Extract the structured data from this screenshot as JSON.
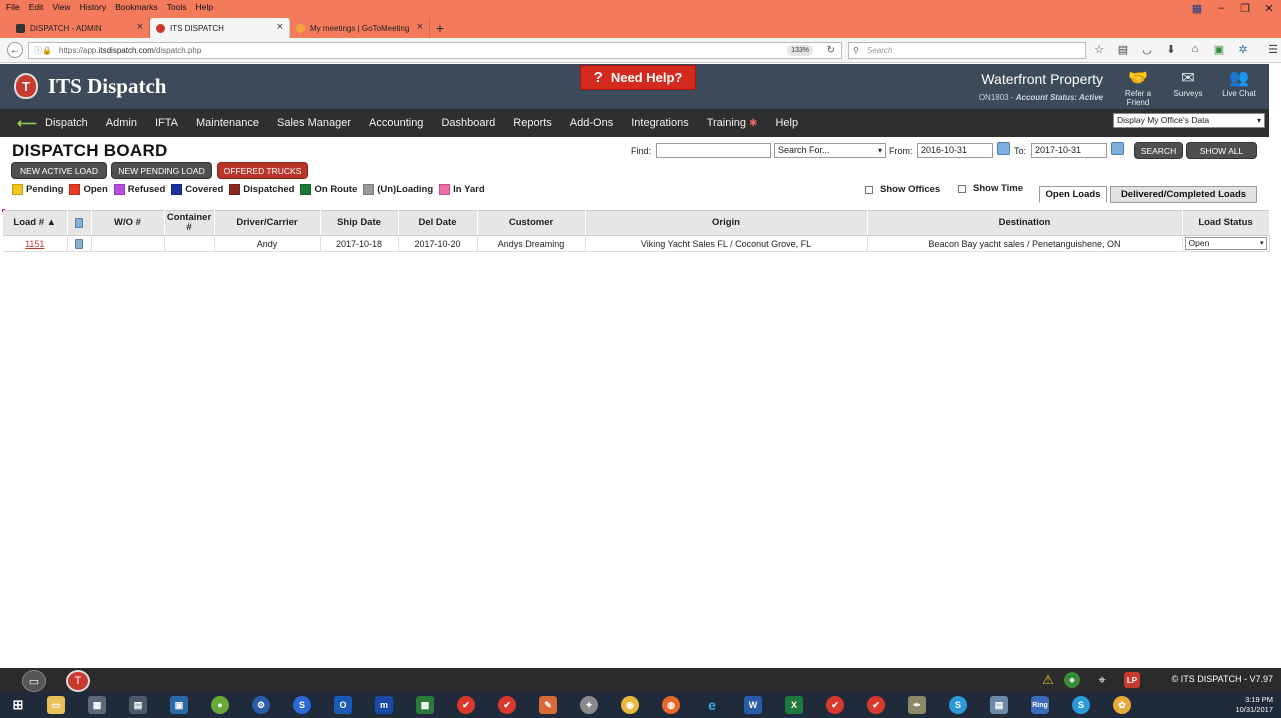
{
  "browser": {
    "menus": [
      "File",
      "Edit",
      "View",
      "History",
      "Bookmarks",
      "Tools",
      "Help"
    ],
    "tabs": [
      {
        "label": "DISPATCH - ADMIN",
        "active": false
      },
      {
        "label": "ITS DISPATCH",
        "active": true
      },
      {
        "label": "My meetings | GoToMeeting",
        "active": false
      }
    ],
    "url_prefix": "https://app.",
    "url_host": "itsdispatch.com",
    "url_path": "/dispatch.php",
    "zoom": "133%",
    "search_placeholder": "Search"
  },
  "app": {
    "logo_text": "ITS Dispatch",
    "need_help": "Need Help?",
    "company": "Waterfront Property",
    "account_id": "ON1803 - ",
    "account_status": "Account Status: Active",
    "header_icons": [
      {
        "name": "refer-a-friend",
        "label": "Refer a Friend"
      },
      {
        "name": "surveys",
        "label": "Surveys"
      },
      {
        "name": "live-chat",
        "label": "Live Chat"
      }
    ],
    "nav": [
      "Dispatch",
      "Admin",
      "IFTA",
      "Maintenance",
      "Sales Manager",
      "Accounting",
      "Dashboard",
      "Reports",
      "Add-Ons",
      "Integrations",
      "Training",
      "Help"
    ],
    "office_select": "Display My Office's Data"
  },
  "board": {
    "title": "DISPATCH BOARD",
    "buttons": {
      "new_active": "NEW ACTIVE LOAD",
      "new_pending": "NEW PENDING LOAD",
      "offered": "OFFERED TRUCKS"
    },
    "find_label": "Find:",
    "find_value": "",
    "search_for": "Search For...",
    "from_label": "From:",
    "from_value": "2016-10-31",
    "to_label": "To:",
    "to_value": "2017-10-31",
    "search_btn": "SEARCH",
    "show_all_btn": "SHOW ALL",
    "legend": [
      {
        "label": "Pending",
        "color": "#f5c518"
      },
      {
        "label": "Open",
        "color": "#e8391e"
      },
      {
        "label": "Refused",
        "color": "#b84ee0"
      },
      {
        "label": "Covered",
        "color": "#1a2fa0"
      },
      {
        "label": "Dispatched",
        "color": "#8a2a1a"
      },
      {
        "label": "On Route",
        "color": "#1e7a3a"
      },
      {
        "label": "(Un)Loading",
        "color": "#9a9a9a"
      },
      {
        "label": "In Yard",
        "color": "#f06aa8"
      }
    ],
    "show_offices": "Show Offices",
    "show_time": "Show Time",
    "tab_open": "Open Loads",
    "tab_delivered": "Delivered/Completed Loads",
    "columns": [
      "Load # ▲",
      "",
      "W/O #",
      "Container #",
      "Driver/Carrier",
      "Ship Date",
      "Del Date",
      "Customer",
      "Origin",
      "Destination",
      "Load Status"
    ],
    "rows": [
      {
        "load": "1151",
        "wo": "",
        "container": "",
        "driver": "Andy",
        "ship": "2017-10-18",
        "del": "2017-10-20",
        "customer": "Andys Dreaming",
        "origin": "Viking Yacht Sales FL / Coconut Grove, FL",
        "destination": "Beacon Bay yacht sales / Penetanguishene, ON",
        "status": "Open"
      }
    ]
  },
  "footer": {
    "copyright": "© ITS DISPATCH  -  V7.97"
  },
  "taskbar": {
    "time": "3:19 PM",
    "date": "10/31/2017"
  }
}
